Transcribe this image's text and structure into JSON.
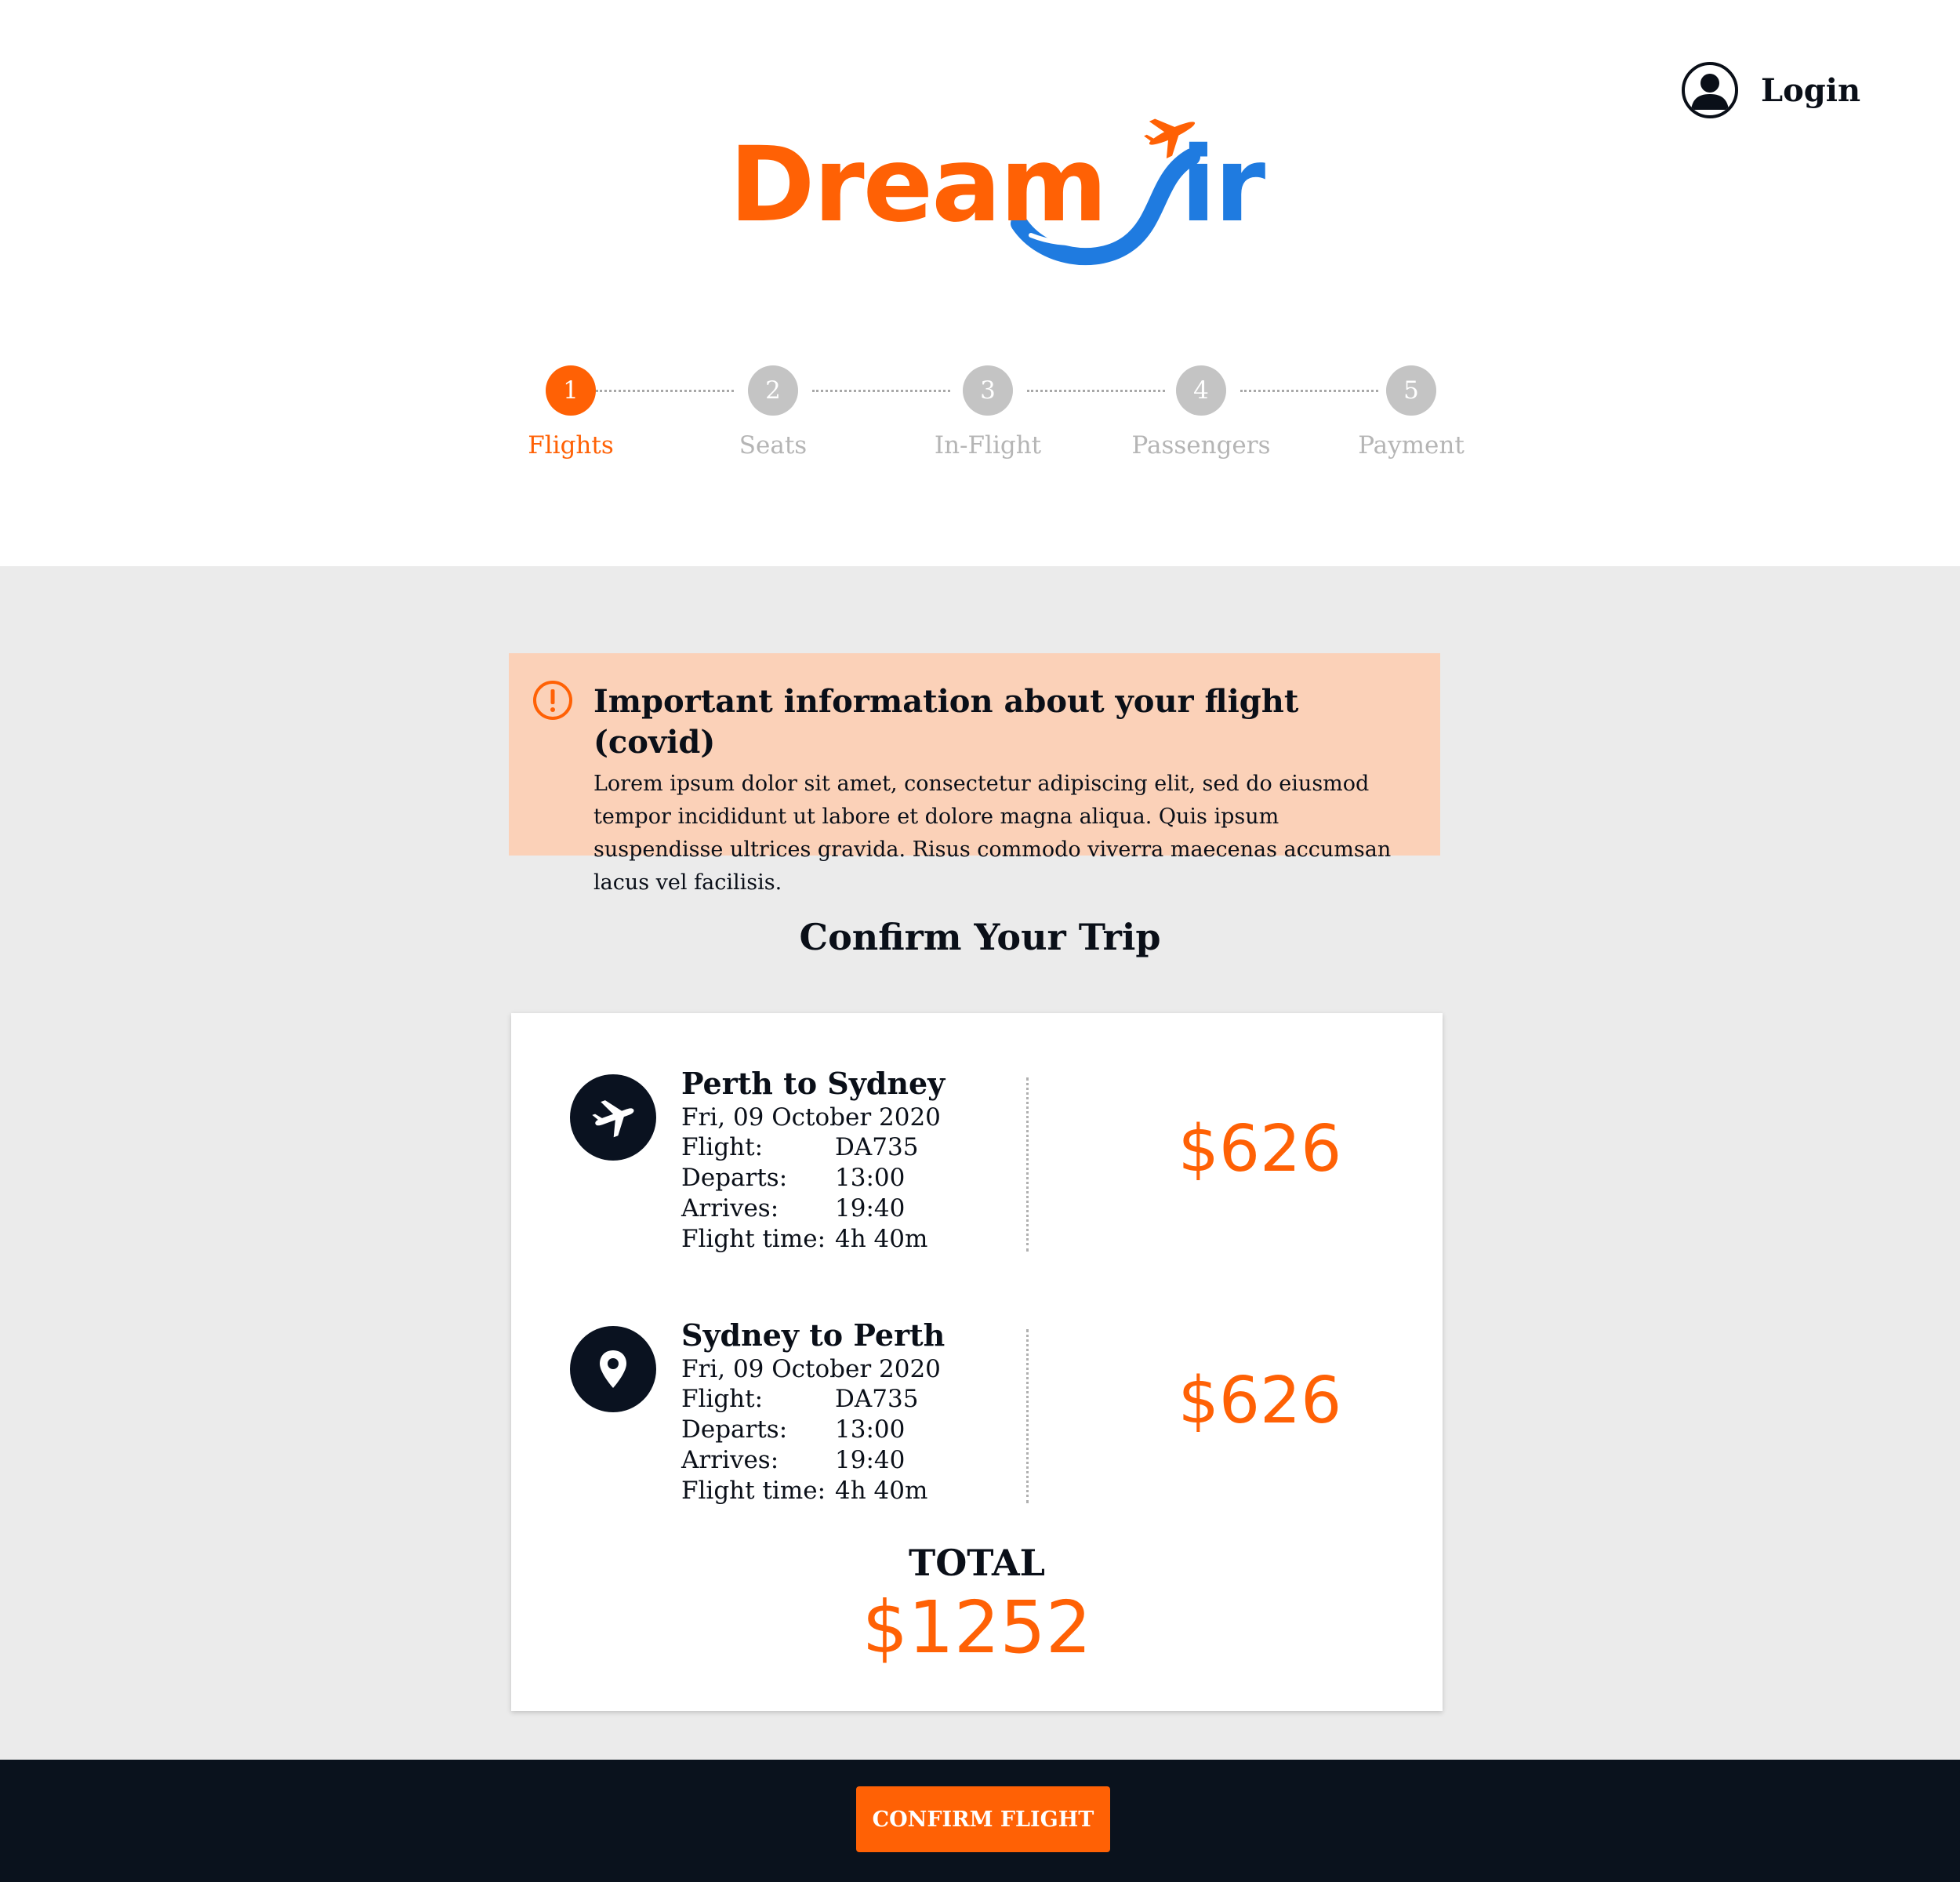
{
  "header": {
    "login_label": "Login",
    "logo": {
      "word_orange": "Dream",
      "word_blue": "ir"
    }
  },
  "stepper": {
    "steps": [
      {
        "number": "1",
        "label": "Flights",
        "active": true
      },
      {
        "number": "2",
        "label": "Seats",
        "active": false
      },
      {
        "number": "3",
        "label": "In-Flight",
        "active": false
      },
      {
        "number": "4",
        "label": "Passengers",
        "active": false
      },
      {
        "number": "5",
        "label": "Payment",
        "active": false
      }
    ]
  },
  "alert": {
    "icon": "exclamation-circle-icon",
    "title": "Important information about your flight (covid)",
    "body": "Lorem ipsum dolor sit amet, consectetur adipiscing elit, sed do eiusmod tempor incididunt ut labore et dolore magna aliqua. Quis ipsum suspendisse ultrices gravida. Risus commodo viverra maecenas accumsan lacus vel facilisis."
  },
  "section_title": "Confirm Your Trip",
  "trips": [
    {
      "icon": "airplane-icon",
      "route": "Perth to Sydney",
      "date": "Fri, 09 October 2020",
      "rows": [
        {
          "k": "Flight:",
          "v": "DA735"
        },
        {
          "k": "Departs:",
          "v": "13:00"
        },
        {
          "k": "Arrives:",
          "v": "19:40"
        },
        {
          "k": "Flight time:",
          "v": "4h 40m"
        }
      ],
      "price": "$626"
    },
    {
      "icon": "map-pin-icon",
      "route": "Sydney to Perth",
      "date": "Fri, 09 October 2020",
      "rows": [
        {
          "k": "Flight:",
          "v": "DA735"
        },
        {
          "k": "Departs:",
          "v": "13:00"
        },
        {
          "k": "Arrives:",
          "v": "19:40"
        },
        {
          "k": "Flight time:",
          "v": "4h 40m"
        }
      ],
      "price": "$626"
    }
  ],
  "total": {
    "label": "TOTAL",
    "value": "$1252"
  },
  "footer": {
    "confirm_label": "CONFIRM FLIGHT"
  },
  "colors": {
    "accent": "#ff6105",
    "brand_blue": "#1f7be0",
    "dark": "#0a121d",
    "alert_bg": "#fbd1b8",
    "step_inactive": "#c4c4c4"
  }
}
